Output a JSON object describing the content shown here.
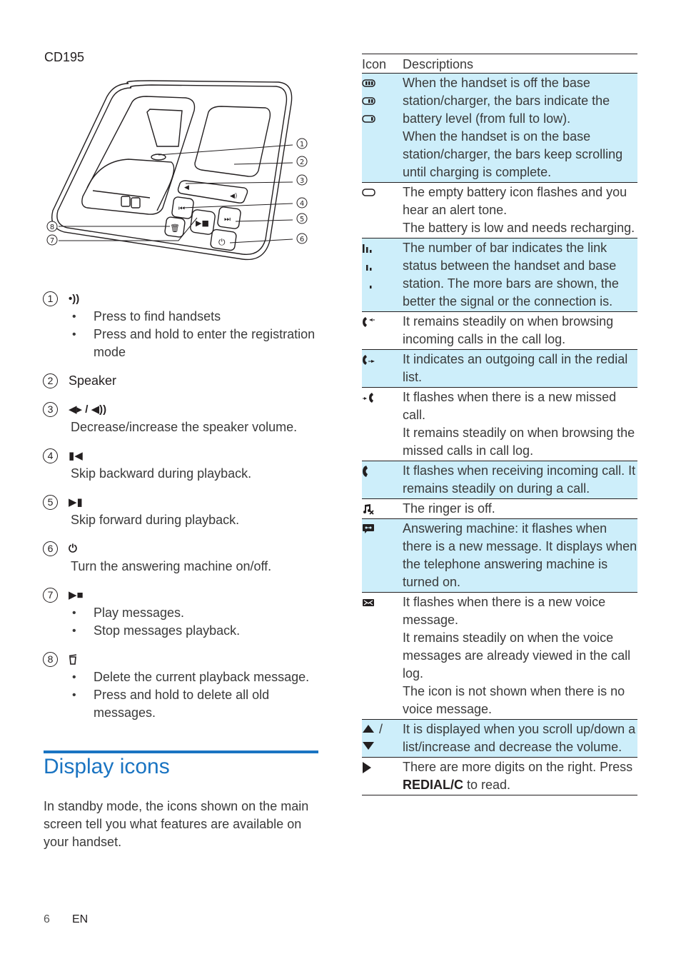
{
  "model_label": "CD195",
  "diagram": {
    "callouts": [
      "1",
      "2",
      "3",
      "4",
      "5",
      "6",
      "7",
      "8"
    ]
  },
  "features": [
    {
      "number": "1",
      "icon": "•))",
      "icon_name": "find-handset-icon",
      "bullets": [
        "Press to find handsets",
        "Press and hold to enter the registration mode"
      ]
    },
    {
      "number": "2",
      "title": "Speaker"
    },
    {
      "number": "3",
      "icon": "◀▸ / ◀))",
      "icon_name": "volume-icon",
      "description": "Decrease/increase the speaker volume."
    },
    {
      "number": "4",
      "icon": "▮◀",
      "icon_name": "skip-backward-icon",
      "description": "Skip backward during playback."
    },
    {
      "number": "5",
      "icon": "▶▮",
      "icon_name": "skip-forward-icon",
      "description": "Skip forward during playback."
    },
    {
      "number": "6",
      "icon": "⏻",
      "icon_name": "power-icon",
      "description": "Turn the answering machine on/off."
    },
    {
      "number": "7",
      "icon": "▶■",
      "icon_name": "play-stop-icon",
      "bullets": [
        "Play messages.",
        "Stop messages playback."
      ]
    },
    {
      "number": "8",
      "icon": "🗑",
      "icon_name": "delete-icon",
      "bullets": [
        "Delete the current playback message.",
        "Press and hold to delete all old messages."
      ]
    }
  ],
  "section": {
    "title": "Display icons",
    "intro": "In standby mode, the icons shown on the main screen tell you what features are available on your handset."
  },
  "footer": {
    "page": "6",
    "lang": "EN"
  },
  "colors": {
    "accent": "#1a74c2",
    "row_shade": "#cdeefa",
    "text": "#231f20"
  },
  "table": {
    "headers": {
      "icon": "Icon",
      "description": "Descriptions"
    },
    "rows": [
      {
        "icons": [
          "battery-full-icon",
          "battery-two-bars-icon",
          "battery-one-bar-icon"
        ],
        "shaded": true,
        "lines": [
          "When the handset is off the base station/charger, the bars indicate the battery level (from full to low).",
          "When the handset is on the base station/charger, the bars keep scrolling until charging is complete."
        ]
      },
      {
        "icons": [
          "battery-empty-icon"
        ],
        "shaded": false,
        "lines": [
          "The empty battery icon flashes and you hear an alert tone.",
          "The battery is low and needs recharging."
        ]
      },
      {
        "icons": [
          "signal-three-bars-icon",
          "signal-two-bars-icon",
          "signal-one-bar-icon"
        ],
        "shaded": true,
        "lines": [
          "The number of bar indicates the link status between the handset and base station. The more bars are shown, the better the signal or the connection is."
        ]
      },
      {
        "icons": [
          "incoming-call-icon"
        ],
        "shaded": false,
        "lines": [
          "It remains steadily on when browsing incoming calls in the call log."
        ]
      },
      {
        "icons": [
          "outgoing-call-icon"
        ],
        "shaded": true,
        "lines": [
          "It indicates an outgoing call in the redial list."
        ]
      },
      {
        "icons": [
          "missed-call-icon"
        ],
        "shaded": false,
        "lines": [
          "It flashes when there is a new missed call.",
          "It remains steadily on when browsing the missed calls in call log."
        ]
      },
      {
        "icons": [
          "phone-icon"
        ],
        "shaded": true,
        "lines": [
          "It flashes when receiving incoming call. It remains steadily on during a call."
        ]
      },
      {
        "icons": [
          "ringer-off-icon"
        ],
        "shaded": false,
        "lines": [
          "The ringer is off."
        ]
      },
      {
        "icons": [
          "answering-machine-icon"
        ],
        "shaded": true,
        "lines": [
          "Answering machine: it flashes when there is a new message. It displays when the telephone answering machine is turned on."
        ]
      },
      {
        "icons": [
          "voice-message-icon"
        ],
        "shaded": false,
        "lines": [
          "It flashes when there is a new voice message.",
          "It remains steadily on when the voice messages are already viewed in the call log.",
          "The icon is not shown when there is no voice message."
        ]
      },
      {
        "icons": [
          "arrow-up-icon",
          "arrow-down-icon"
        ],
        "icon_separator": "/",
        "shaded": true,
        "lines": [
          "It is displayed when you scroll up/down a list/increase and decrease the volume."
        ]
      },
      {
        "icons": [
          "arrow-right-icon"
        ],
        "shaded": false,
        "lines_rich": {
          "before": "There are more digits on the right. Press ",
          "bold": "REDIAL/C",
          "after": " to read."
        }
      }
    ]
  }
}
